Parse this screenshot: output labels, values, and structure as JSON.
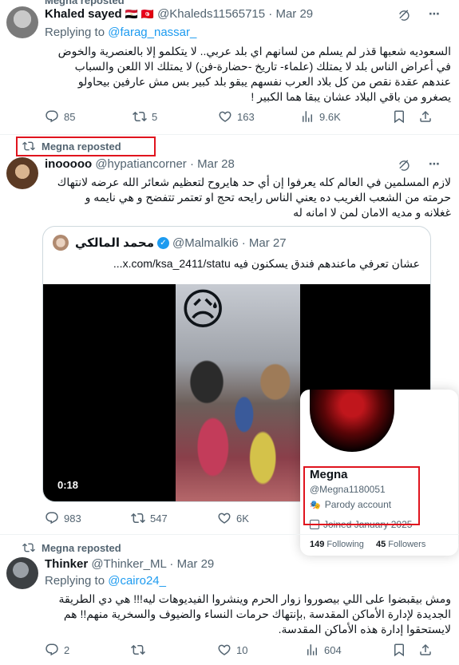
{
  "top_clip_label": "Megna reposted",
  "tweet1": {
    "name": "Khaled sayed",
    "flags": "🇪🇬 🇹🇳",
    "handle": "@Khaleds11565715",
    "date": "· Mar 29",
    "replying_prefix": "Replying to",
    "replying_to": "@farag_nassar_",
    "lines": [
      "السعوديه شعبها قذر لم يسلم من لسانهم اي بلد عربي.. لا يتكلمو إلا بالعنصرية والخوض",
      "في أعراض الناس  بلد لا يمتلك (علماء- تاريخ -حضارة-فن) لا يمتلك الا اللعن والسباب",
      "عندهم عقدة نقص من كل بلاد العرب  نفسهم يبقو بلد كبير بس مش عارفين بيحاولو",
      "يصغرو من باقي البلاد عشان يبقا هما الكبير !"
    ],
    "replies": "85",
    "reposts": "5",
    "likes": "163",
    "views": "9.6K"
  },
  "tweet2": {
    "repost_label": "Megna reposted",
    "name": "inooooo",
    "handle": "@hypatiancorner",
    "date": "· Mar 28",
    "lines": [
      "لازم المسلمين في العالم كله يعرفوا إن أي حد هايروح لتعظيم شعائر الله عرضه لانتهاك",
      "حرمته من الشعب الغريب ده يعني الناس رايحه تحج او تعتمر تتفضح و هي نايمه و",
      "غغلانه و مديه الامان لمن لا امانه له"
    ],
    "quote": {
      "name": "محمد المالكي",
      "handle": "@Malmalki6",
      "date": "· Mar 27",
      "text": "عشان تعرفي ماعندهم فندق يسكنون فيه  x.com/ksa_2411/statu...",
      "video_time": "0:18",
      "emoji": "😥"
    },
    "replies": "983",
    "reposts": "547",
    "likes": "6K",
    "views": ""
  },
  "hovercard": {
    "name": "Megna",
    "handle": "@Megna1180051",
    "parody": "Parody account",
    "joined": "Joined January 2025",
    "following_count": "149",
    "following_label": "Following",
    "followers_count": "45",
    "followers_label": "Followers"
  },
  "tweet3": {
    "repost_label": "Megna reposted",
    "name": "Thinker",
    "handle": "@Thinker_ML",
    "date": "· Mar 29",
    "replying_prefix": "Replying to",
    "replying_to": "@cairo24_",
    "lines": [
      "ومش بيقبضوا على اللي بيصوروا زوار الحرم وينشروا الفيديوهات ليه!!! هي دي الطريقة",
      "الجديدة لإدارة الأماكن المقدسة ,بإنتهاك حرمات النساء والضيوف والسخرية منهم!! هم",
      "لايستحقوا إدارة هذه الأماكن المقدسة."
    ],
    "replies": "2",
    "reposts": "",
    "likes": "10",
    "views": "604"
  },
  "colors": {
    "accent": "#1d9bf0",
    "highlight": "#e0141e",
    "muted": "#536471",
    "text": "#0f1419"
  }
}
